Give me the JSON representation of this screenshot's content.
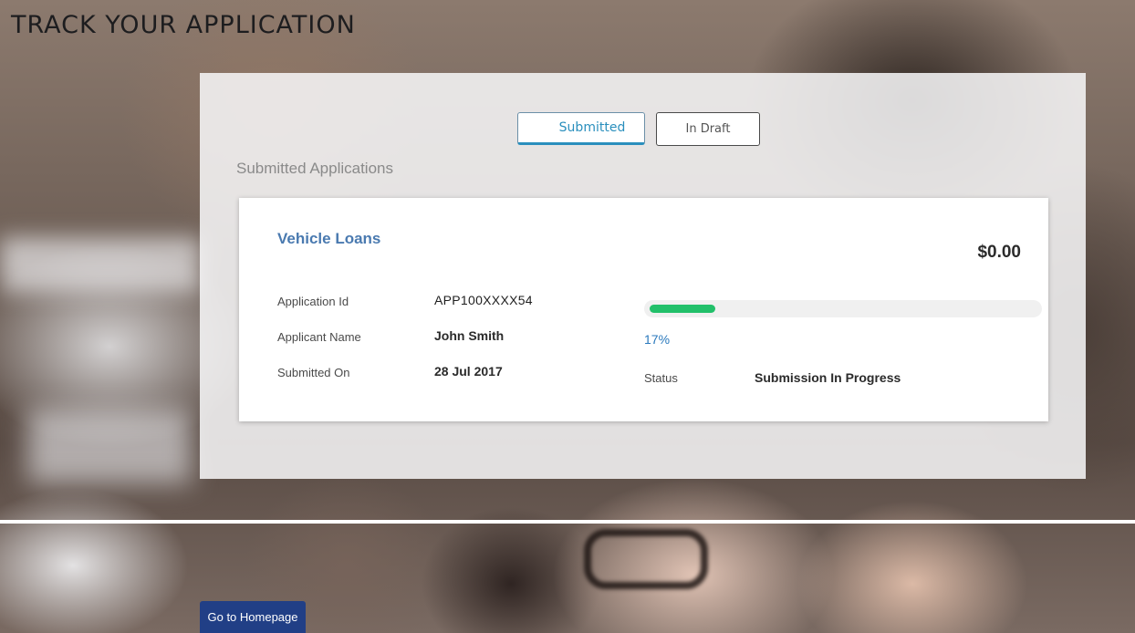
{
  "page": {
    "title": "TRACK YOUR APPLICATION"
  },
  "tabs": [
    {
      "label": "Submitted",
      "active": true
    },
    {
      "label": "In Draft",
      "active": false
    }
  ],
  "section_title": "Submitted Applications",
  "application": {
    "product": "Vehicle Loans",
    "amount": "$0.00",
    "fields": [
      {
        "label": "Application Id",
        "value": "APP100XXXX54"
      },
      {
        "label": "Applicant Name",
        "value": "John Smith"
      },
      {
        "label": "Submitted On",
        "value": "28 Jul 2017"
      }
    ],
    "progress_percent": 17,
    "progress_label": "17%",
    "status_label": "Status",
    "status_value": "Submission In Progress"
  },
  "footer": {
    "home_button": "Go to Homepage"
  },
  "colors": {
    "accent": "#2a8fbd",
    "product_link": "#4a7ab0",
    "progress": "#22c06a",
    "button": "#213f86"
  }
}
